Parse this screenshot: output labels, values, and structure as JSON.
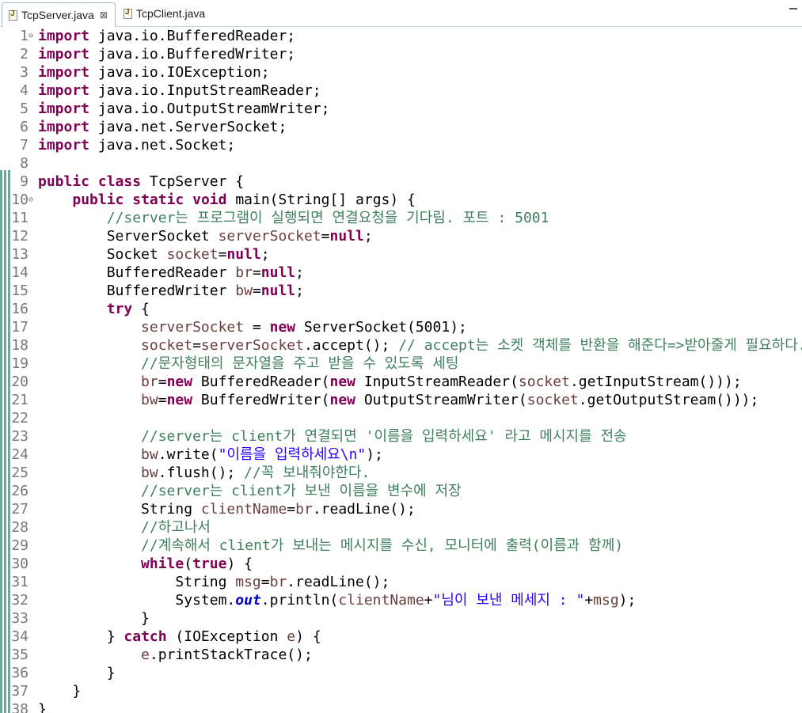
{
  "tabs": [
    {
      "label": "TcpServer.java",
      "active": true
    },
    {
      "label": "TcpClient.java",
      "active": false
    }
  ],
  "close_glyph": "⊠",
  "colors": {
    "keyword": "#7f0055",
    "comment": "#3f7f5f",
    "string": "#2a00ff",
    "local_var": "#6a3e3e",
    "static_field": "#0000c0"
  },
  "code_lines": [
    {
      "n": "1",
      "fold": "⊖",
      "indent": 0,
      "segs": [
        [
          "kw",
          "import"
        ],
        [
          "",
          "java.io.BufferedReader;"
        ]
      ]
    },
    {
      "n": "2",
      "fold": "",
      "indent": 0,
      "segs": [
        [
          "kw",
          "import"
        ],
        [
          "",
          "java.io.BufferedWriter;"
        ]
      ]
    },
    {
      "n": "3",
      "fold": "",
      "indent": 0,
      "segs": [
        [
          "kw",
          "import"
        ],
        [
          "",
          "java.io.IOException;"
        ]
      ]
    },
    {
      "n": "4",
      "fold": "",
      "indent": 0,
      "segs": [
        [
          "kw",
          "import"
        ],
        [
          "",
          "java.io.InputStreamReader;"
        ]
      ]
    },
    {
      "n": "5",
      "fold": "",
      "indent": 0,
      "segs": [
        [
          "kw",
          "import"
        ],
        [
          "",
          "java.io.OutputStreamWriter;"
        ]
      ]
    },
    {
      "n": "6",
      "fold": "",
      "indent": 0,
      "segs": [
        [
          "kw",
          "import"
        ],
        [
          "",
          "java.net.ServerSocket;"
        ]
      ]
    },
    {
      "n": "7",
      "fold": "",
      "indent": 0,
      "segs": [
        [
          "kw",
          "import"
        ],
        [
          "",
          "java.net.Socket;"
        ]
      ]
    },
    {
      "n": "8",
      "fold": "",
      "indent": 0,
      "segs": []
    },
    {
      "n": "9",
      "fold": "",
      "indent": 0,
      "segs": [
        [
          "kw",
          "public"
        ],
        [
          "kw",
          "class"
        ],
        [
          "",
          "TcpServer {"
        ]
      ]
    },
    {
      "n": "10",
      "fold": "⊖",
      "indent": 1,
      "segs": [
        [
          "kw",
          "public"
        ],
        [
          "kw",
          "static"
        ],
        [
          "kw",
          "void"
        ],
        [
          "",
          "main(String[] args) {"
        ]
      ]
    },
    {
      "n": "11",
      "fold": "",
      "indent": 2,
      "segs": [
        [
          "cm",
          "//server는 프로그램이 실행되면 연결요청을 기다림. 포트 : 5001"
        ]
      ]
    },
    {
      "n": "12",
      "fold": "",
      "indent": 2,
      "segs": [
        [
          "",
          "ServerSocket "
        ],
        [
          "var",
          "serverSocket"
        ],
        [
          "",
          "="
        ],
        [
          "kw",
          "null"
        ],
        [
          "",
          ";"
        ]
      ]
    },
    {
      "n": "13",
      "fold": "",
      "indent": 2,
      "segs": [
        [
          "",
          "Socket "
        ],
        [
          "var",
          "socket"
        ],
        [
          "",
          "="
        ],
        [
          "kw",
          "null"
        ],
        [
          "",
          ";"
        ]
      ]
    },
    {
      "n": "14",
      "fold": "",
      "indent": 2,
      "segs": [
        [
          "",
          "BufferedReader "
        ],
        [
          "var",
          "br"
        ],
        [
          "",
          "="
        ],
        [
          "kw",
          "null"
        ],
        [
          "",
          ";"
        ]
      ]
    },
    {
      "n": "15",
      "fold": "",
      "indent": 2,
      "segs": [
        [
          "",
          "BufferedWriter "
        ],
        [
          "var",
          "bw"
        ],
        [
          "",
          "="
        ],
        [
          "kw",
          "null"
        ],
        [
          "",
          ";"
        ]
      ]
    },
    {
      "n": "16",
      "fold": "",
      "indent": 2,
      "segs": [
        [
          "kw",
          "try"
        ],
        [
          "",
          " {"
        ]
      ]
    },
    {
      "n": "17",
      "fold": "",
      "indent": 3,
      "segs": [
        [
          "var",
          "serverSocket"
        ],
        [
          "",
          " = "
        ],
        [
          "kw",
          "new"
        ],
        [
          "",
          " ServerSocket(5001);"
        ]
      ]
    },
    {
      "n": "18",
      "fold": "",
      "indent": 3,
      "segs": [
        [
          "var",
          "socket"
        ],
        [
          "",
          "="
        ],
        [
          "var",
          "serverSocket"
        ],
        [
          "",
          ".accept(); "
        ],
        [
          "cm",
          "// accept는 소켓 객체를 반환을 해준다=>받아줄게 필요하다."
        ]
      ]
    },
    {
      "n": "19",
      "fold": "",
      "indent": 3,
      "segs": [
        [
          "cm",
          "//문자형태의 문자열을 주고 받을 수 있도록 세팅"
        ]
      ]
    },
    {
      "n": "20",
      "fold": "",
      "indent": 3,
      "segs": [
        [
          "var",
          "br"
        ],
        [
          "",
          "="
        ],
        [
          "kw",
          "new"
        ],
        [
          "",
          " BufferedReader("
        ],
        [
          "kw",
          "new"
        ],
        [
          "",
          " InputStreamReader("
        ],
        [
          "var",
          "socket"
        ],
        [
          "",
          ".getInputStream()));"
        ]
      ]
    },
    {
      "n": "21",
      "fold": "",
      "indent": 3,
      "segs": [
        [
          "var",
          "bw"
        ],
        [
          "",
          "="
        ],
        [
          "kw",
          "new"
        ],
        [
          "",
          " BufferedWriter("
        ],
        [
          "kw",
          "new"
        ],
        [
          "",
          " OutputStreamWriter("
        ],
        [
          "var",
          "socket"
        ],
        [
          "",
          ".getOutputStream()));"
        ]
      ]
    },
    {
      "n": "22",
      "fold": "",
      "indent": 0,
      "segs": []
    },
    {
      "n": "23",
      "fold": "",
      "indent": 3,
      "segs": [
        [
          "cm",
          "//server는 client가 연결되면 '이름을 입력하세요' 라고 메시지를 전송"
        ]
      ]
    },
    {
      "n": "24",
      "fold": "",
      "indent": 3,
      "segs": [
        [
          "var",
          "bw"
        ],
        [
          "",
          ".write("
        ],
        [
          "str",
          "\"이름을 입력하세요\\n\""
        ],
        [
          "",
          ");"
        ]
      ]
    },
    {
      "n": "25",
      "fold": "",
      "indent": 3,
      "segs": [
        [
          "var",
          "bw"
        ],
        [
          "",
          ".flush(); "
        ],
        [
          "cm",
          "//꼭 보내줘야한다."
        ]
      ]
    },
    {
      "n": "26",
      "fold": "",
      "indent": 3,
      "segs": [
        [
          "cm",
          "//server는 client가 보낸 이름을 변수에 저장"
        ]
      ]
    },
    {
      "n": "27",
      "fold": "",
      "indent": 3,
      "segs": [
        [
          "",
          "String "
        ],
        [
          "var",
          "clientName"
        ],
        [
          "",
          "="
        ],
        [
          "var",
          "br"
        ],
        [
          "",
          ".readLine();"
        ]
      ]
    },
    {
      "n": "28",
      "fold": "",
      "indent": 3,
      "segs": [
        [
          "cm",
          "//하고나서"
        ]
      ]
    },
    {
      "n": "29",
      "fold": "",
      "indent": 3,
      "segs": [
        [
          "cm",
          "//계속해서 client가 보내는 메시지를 수신, 모니터에 출력(이름과 함께)"
        ]
      ]
    },
    {
      "n": "30",
      "fold": "",
      "indent": 3,
      "segs": [
        [
          "kw",
          "while"
        ],
        [
          "",
          "("
        ],
        [
          "kw",
          "true"
        ],
        [
          "",
          ") {"
        ]
      ]
    },
    {
      "n": "31",
      "fold": "",
      "indent": 4,
      "segs": [
        [
          "",
          "String "
        ],
        [
          "var",
          "msg"
        ],
        [
          "",
          "="
        ],
        [
          "var",
          "br"
        ],
        [
          "",
          ".readLine();"
        ]
      ]
    },
    {
      "n": "32",
      "fold": "",
      "indent": 4,
      "segs": [
        [
          "",
          "System."
        ],
        [
          "fld",
          "out"
        ],
        [
          "",
          ".println("
        ],
        [
          "var",
          "clientName"
        ],
        [
          "",
          "+"
        ],
        [
          "str",
          "\"님이 보낸 메세지 : \""
        ],
        [
          "",
          "+"
        ],
        [
          "var",
          "msg"
        ],
        [
          "",
          ");"
        ]
      ]
    },
    {
      "n": "33",
      "fold": "",
      "indent": 3,
      "segs": [
        [
          "",
          "}"
        ]
      ]
    },
    {
      "n": "34",
      "fold": "",
      "indent": 2,
      "segs": [
        [
          "",
          "} "
        ],
        [
          "kw",
          "catch"
        ],
        [
          "",
          " (IOException "
        ],
        [
          "var",
          "e"
        ],
        [
          "",
          ") {"
        ]
      ]
    },
    {
      "n": "35",
      "fold": "",
      "indent": 3,
      "segs": [
        [
          "var",
          "e"
        ],
        [
          "",
          ".printStackTrace();"
        ]
      ]
    },
    {
      "n": "36",
      "fold": "",
      "indent": 2,
      "segs": [
        [
          "",
          "}"
        ]
      ]
    },
    {
      "n": "37",
      "fold": "",
      "indent": 1,
      "segs": [
        [
          "",
          "}"
        ]
      ]
    },
    {
      "n": "38",
      "fold": "",
      "indent": 0,
      "segs": [
        [
          "",
          "}"
        ]
      ]
    }
  ]
}
